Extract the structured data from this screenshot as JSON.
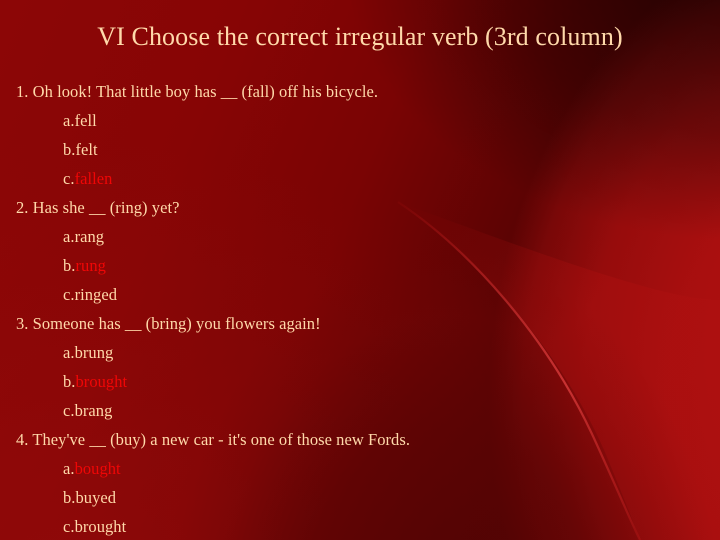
{
  "slide": {
    "title": "VI Choose the correct irregular verb (3rd column)",
    "colors": {
      "background_dark": "#330101",
      "background_mid": "#7a0404",
      "background_light": "#ba1212",
      "text": "#ffd9aa",
      "correct_answer": "#ef0606"
    },
    "questions": [
      {
        "number": "1.",
        "text": "1. Oh look! That little boy has __ (fall) off his bicycle.",
        "options": [
          {
            "letter": "a.",
            "word": "fell",
            "correct": false
          },
          {
            "letter": "b.",
            "word": "felt",
            "correct": false
          },
          {
            "letter": "c.",
            "word": "fallen",
            "correct": true
          }
        ]
      },
      {
        "number": "2.",
        "text": "2. Has she __ (ring) yet?",
        "options": [
          {
            "letter": "a.",
            "word": "rang",
            "correct": false
          },
          {
            "letter": "b.",
            "word": "rung",
            "correct": true
          },
          {
            "letter": "c.",
            "word": "ringed",
            "correct": false
          }
        ]
      },
      {
        "number": "3.",
        "text": "3. Someone has __ (bring) you flowers again!",
        "options": [
          {
            "letter": "a.",
            "word": "brung",
            "correct": false
          },
          {
            "letter": "b.",
            "word": "brought",
            "correct": true
          },
          {
            "letter": "c.",
            "word": "brang",
            "correct": false
          }
        ]
      },
      {
        "number": "4.",
        "text": "4. They've __ (buy) a new car - it's one of those new Fords.",
        "options": [
          {
            "letter": "a.",
            "word": "bought",
            "correct": true
          },
          {
            "letter": "b.",
            "word": "buyed",
            "correct": false
          },
          {
            "letter": "c.",
            "word": "brought",
            "correct": false
          }
        ]
      }
    ]
  }
}
